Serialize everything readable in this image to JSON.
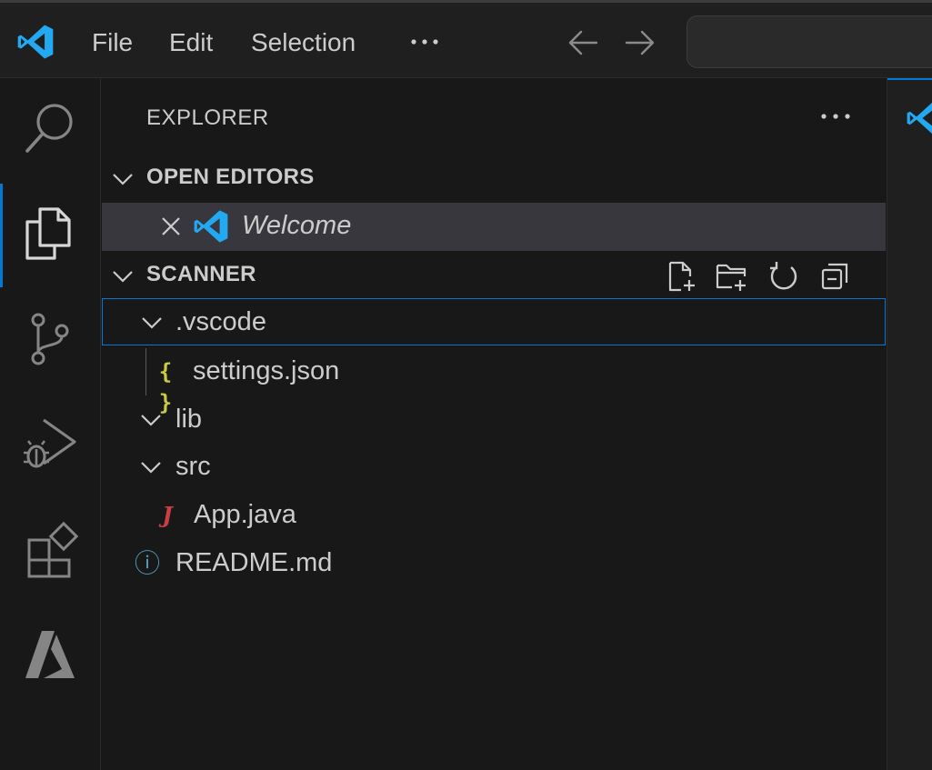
{
  "menu": {
    "file": "File",
    "edit": "Edit",
    "selection": "Selection"
  },
  "icons": {
    "app_logo": "vscode-logo-icon",
    "menu_more": "ellipsis-icon",
    "back": "arrow-left-icon",
    "forward": "arrow-right-icon",
    "activity": [
      "search-icon",
      "explorer-files-icon",
      "source-control-icon",
      "run-debug-icon",
      "extensions-icon",
      "azure-icon"
    ]
  },
  "sidebar": {
    "title": "EXPLORER",
    "open_editors": {
      "header": "OPEN EDITORS",
      "items": [
        {
          "name": "Welcome"
        }
      ]
    },
    "folder": {
      "header": "SCANNER",
      "actions": [
        "new-file-icon",
        "new-folder-icon",
        "refresh-icon",
        "collapse-all-icon"
      ],
      "tree": [
        {
          "label": ".vscode",
          "kind": "folder"
        },
        {
          "label": "settings.json",
          "kind": "file",
          "icon_text": "{ }"
        },
        {
          "label": "lib",
          "kind": "folder"
        },
        {
          "label": "src",
          "kind": "folder"
        },
        {
          "label": "App.java",
          "kind": "file",
          "icon_text": "J"
        },
        {
          "label": "README.md",
          "kind": "file",
          "icon_text": "ⓘ"
        }
      ]
    }
  },
  "colors": {
    "accent": "#0078d4",
    "vscode_blue": "#23a9f2",
    "json_yellow": "#cbcb41",
    "java_red": "#cc3e44",
    "info_blue": "#519aba"
  }
}
